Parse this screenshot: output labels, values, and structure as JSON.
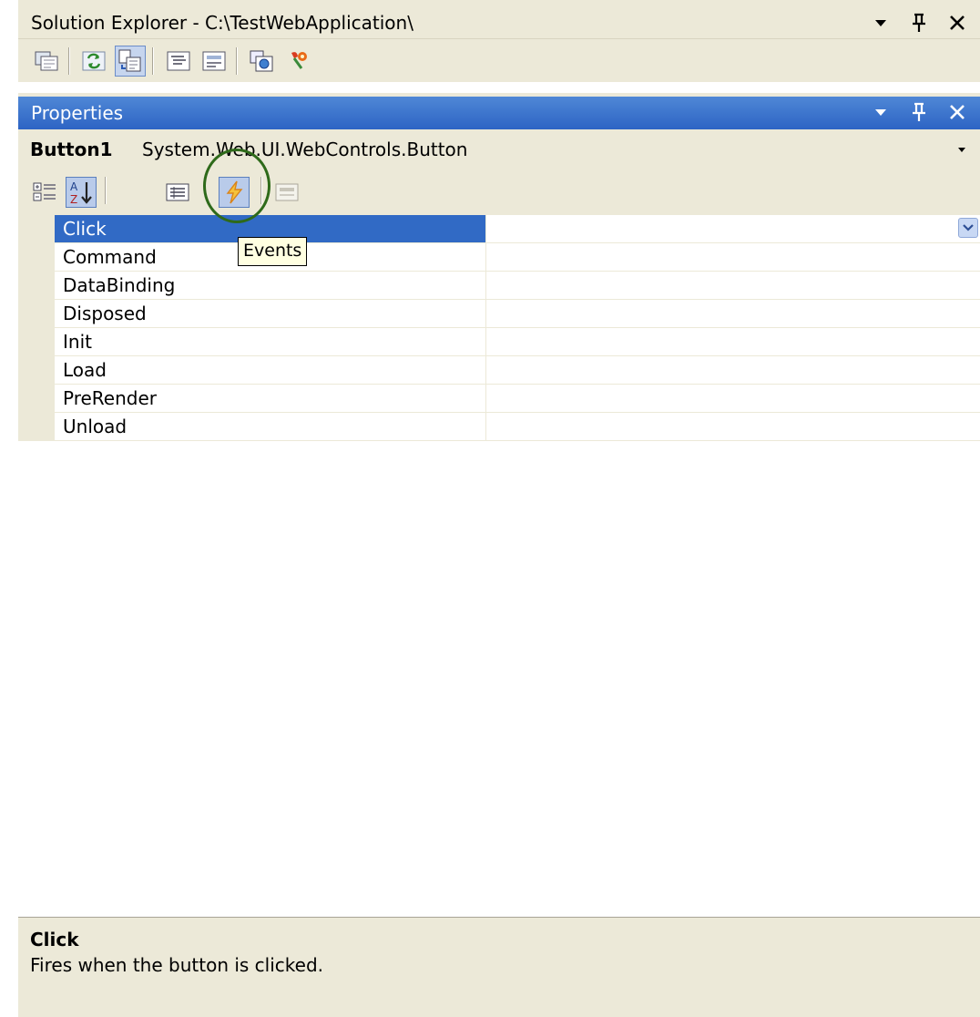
{
  "solution_explorer": {
    "title": "Solution Explorer - C:\\TestWebApplication\\",
    "toolbar_icons": [
      "properties-icon",
      "refresh-icon",
      "show-all-files-icon",
      "view-code-icon",
      "view-designer-icon",
      "copy-website-icon",
      "asp-net-configuration-icon"
    ]
  },
  "properties": {
    "title": "Properties",
    "object_name": "Button1",
    "object_type": "System.Web.UI.WebControls.Button",
    "toolbar_icons": [
      "categorized-icon",
      "alphabetical-icon",
      "properties-view-icon",
      "events-icon",
      "property-pages-icon"
    ],
    "tooltip": "Events",
    "events": [
      {
        "name": "Click",
        "value": ""
      },
      {
        "name": "Command",
        "value": ""
      },
      {
        "name": "DataBinding",
        "value": ""
      },
      {
        "name": "Disposed",
        "value": ""
      },
      {
        "name": "Init",
        "value": ""
      },
      {
        "name": "Load",
        "value": ""
      },
      {
        "name": "PreRender",
        "value": ""
      },
      {
        "name": "Unload",
        "value": ""
      }
    ],
    "selected_event": "Click",
    "description": {
      "title": "Click",
      "text": "Fires when the button is clicked."
    }
  },
  "colors": {
    "title_active": "#316ac5",
    "selection": "#316ac5",
    "panel": "#ece9d8",
    "highlight_circle": "#2e6a1a"
  }
}
